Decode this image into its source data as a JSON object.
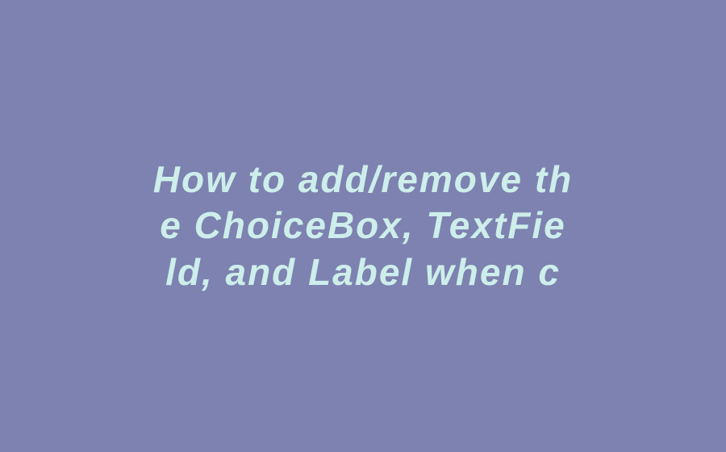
{
  "text": {
    "line1": "How to add/remove th",
    "line2": "e ChoiceBox, TextFie",
    "line3": "ld, and Label when c"
  }
}
